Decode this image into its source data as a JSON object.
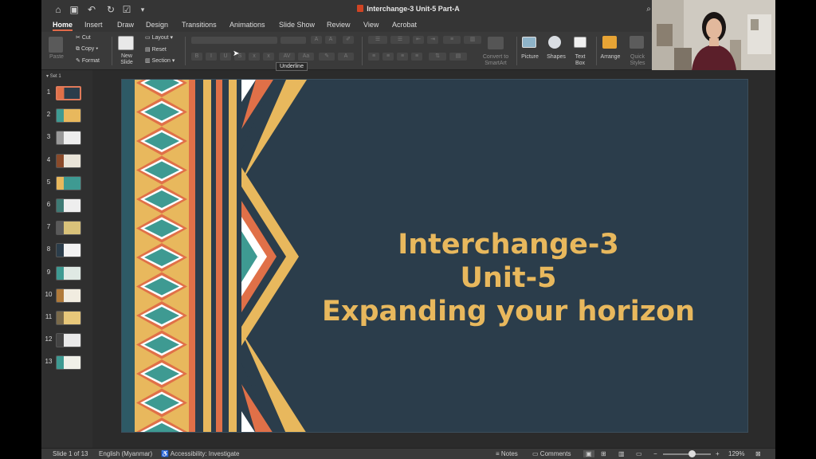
{
  "window": {
    "title": "Interchange-3 Unit-5 Part-A"
  },
  "tabs": [
    {
      "label": "Home",
      "active": true
    },
    {
      "label": "Insert"
    },
    {
      "label": "Draw"
    },
    {
      "label": "Design"
    },
    {
      "label": "Transitions"
    },
    {
      "label": "Animations"
    },
    {
      "label": "Slide Show"
    },
    {
      "label": "Review"
    },
    {
      "label": "View"
    },
    {
      "label": "Acrobat"
    }
  ],
  "ribbon": {
    "paste": "Paste",
    "cut": "Cut",
    "copy": "Copy",
    "format": "Format",
    "new_slide": "New\nSlide",
    "layout": "Layout",
    "reset": "Reset",
    "section": "Section",
    "convert_smartart": "Convert to\nSmartArt",
    "picture": "Picture",
    "shapes": "Shapes",
    "text_box": "Text\nBox",
    "arrange": "Arrange",
    "quick_styles": "Quick\nStyles",
    "tooltip": "Underline"
  },
  "sidebar": {
    "set_label": "Set 1",
    "slides": [
      {
        "num": "1",
        "selected": true
      },
      {
        "num": "2"
      },
      {
        "num": "3"
      },
      {
        "num": "4"
      },
      {
        "num": "5"
      },
      {
        "num": "6"
      },
      {
        "num": "7"
      },
      {
        "num": "8"
      },
      {
        "num": "9"
      },
      {
        "num": "10"
      },
      {
        "num": "11"
      },
      {
        "num": "12"
      },
      {
        "num": "13"
      }
    ]
  },
  "slide": {
    "line1": "Interchange-3",
    "line2": "Unit-5",
    "line3": "Expanding your horizon",
    "background_color": "#2b3d4b",
    "text_color": "#e8b85d"
  },
  "status": {
    "slide_counter": "Slide 1 of 13",
    "language": "English (Myanmar)",
    "accessibility": "Accessibility: Investigate",
    "notes": "Notes",
    "comments": "Comments",
    "zoom": "129%"
  },
  "colors": {
    "accent": "#e06a4a",
    "teal": "#3e9a92",
    "orange": "#e07048",
    "gold": "#e8b85d"
  }
}
